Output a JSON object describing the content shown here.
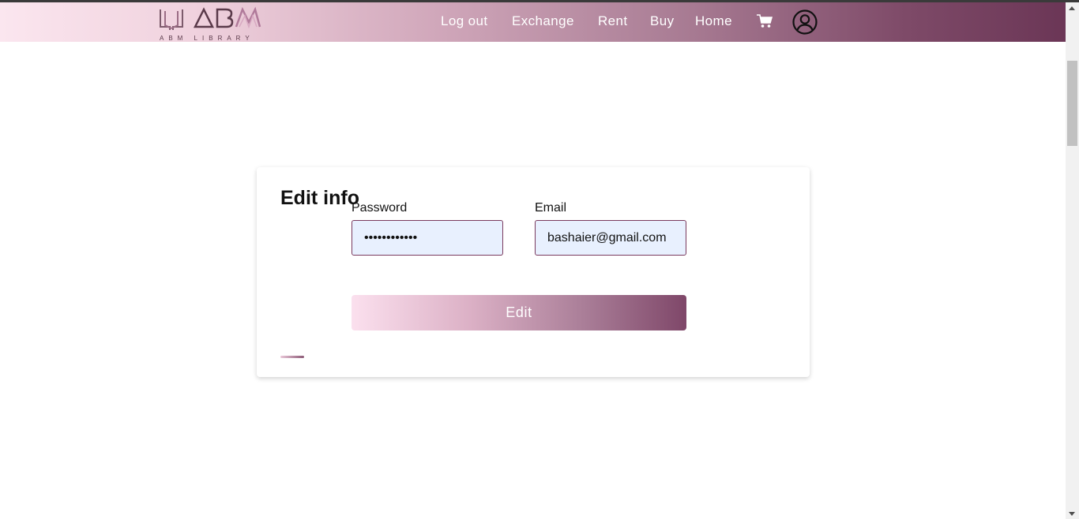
{
  "header": {
    "logo_text": "ABM",
    "logo_subtext": "ABM LIBRARY",
    "nav": [
      {
        "label": "Log out"
      },
      {
        "label": "Exchange"
      },
      {
        "label": "Rent"
      },
      {
        "label": "Buy"
      },
      {
        "label": "Home"
      }
    ],
    "icons": [
      "cart-icon",
      "user-account-icon"
    ]
  },
  "form": {
    "title": "Edit info",
    "password": {
      "label": "Password",
      "value": "••••••••••••"
    },
    "email": {
      "label": "Email",
      "value": "bashaier@gmail.com"
    },
    "submit_label": "Edit"
  },
  "colors": {
    "brand_dark": "#6b3656",
    "brand_light": "#fbe6ef",
    "input_bg": "#e8f0fe",
    "input_border": "#7a3a5e"
  }
}
